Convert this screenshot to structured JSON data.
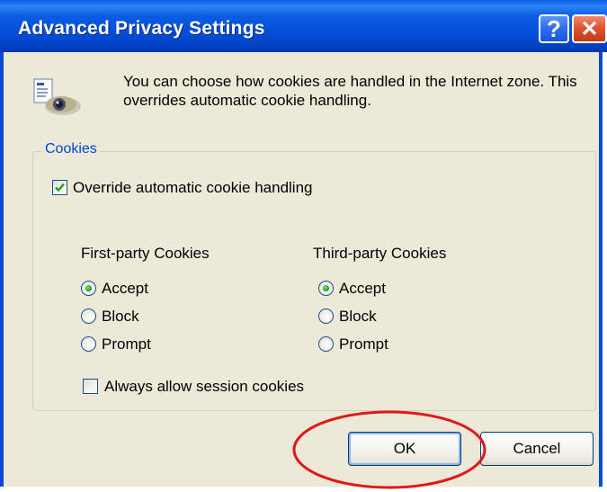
{
  "window": {
    "title": "Advanced Privacy Settings",
    "help_glyph": "?",
    "close_glyph": "✕"
  },
  "description": "You can choose how cookies are handled in the Internet zone.  This overrides automatic cookie handling.",
  "cookies_group": {
    "legend": "Cookies",
    "override": {
      "label": "Override automatic cookie handling",
      "checked": true
    },
    "first_party": {
      "heading": "First-party Cookies",
      "options": [
        "Accept",
        "Block",
        "Prompt"
      ],
      "selected": "Accept"
    },
    "third_party": {
      "heading": "Third-party Cookies",
      "options": [
        "Accept",
        "Block",
        "Prompt"
      ],
      "selected": "Accept"
    },
    "session": {
      "label": "Always allow session cookies",
      "checked": false
    }
  },
  "buttons": {
    "ok": "OK",
    "cancel": "Cancel"
  },
  "colors": {
    "title_bar": "#0450D8",
    "dialog_bg": "#ECE9D8",
    "group_label": "#0046D5",
    "annotation": "#E01818"
  }
}
